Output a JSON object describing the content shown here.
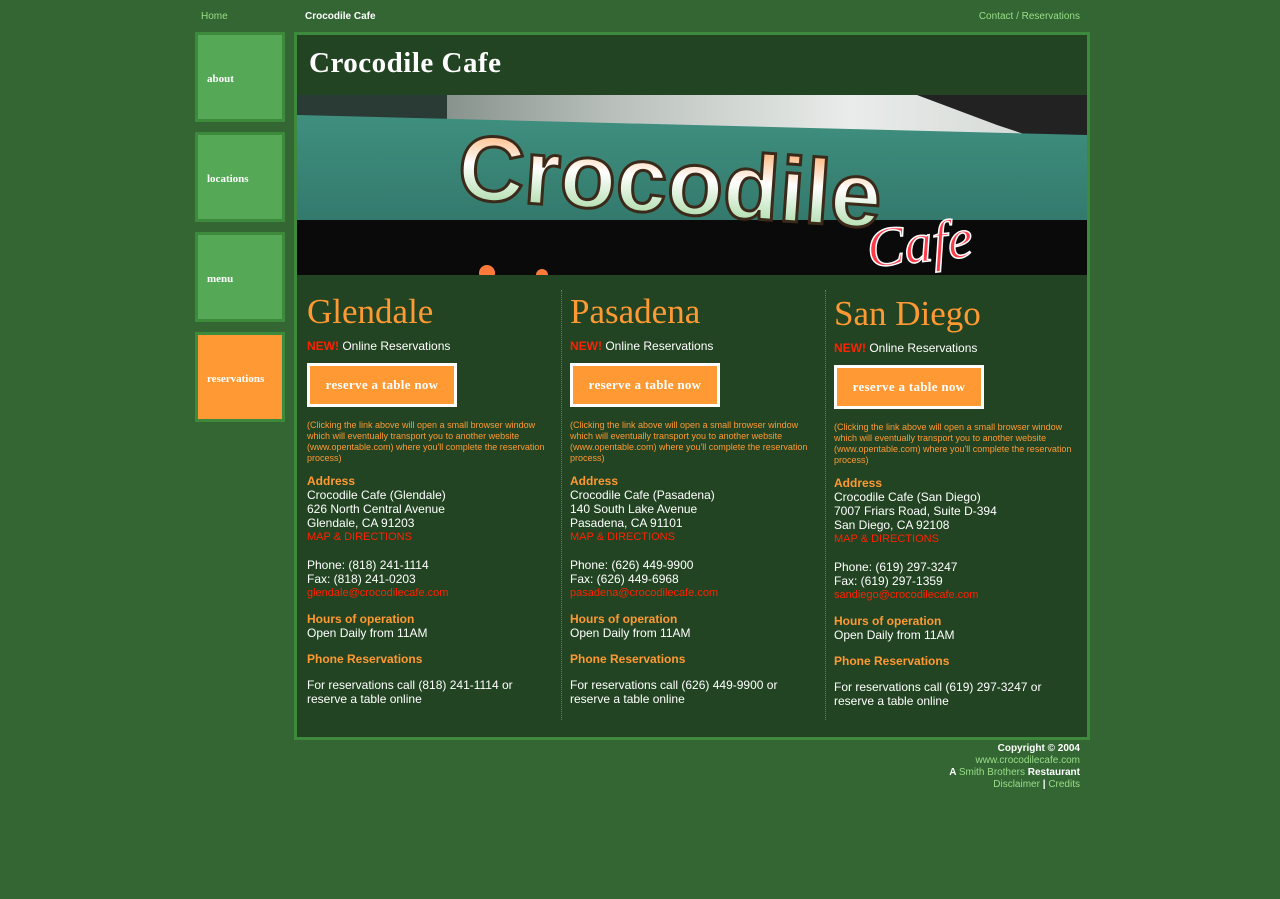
{
  "topbar": {
    "home": "Home",
    "site_title": "Crocodile Cafe",
    "contact": "Contact / Reservations"
  },
  "nav": [
    {
      "label": "about"
    },
    {
      "label": "locations"
    },
    {
      "label": "menu"
    },
    {
      "label": "reservations"
    }
  ],
  "main": {
    "title": "Crocodile Cafe",
    "banner": {
      "sign_word": "Crocodile",
      "sign_cafe": "Cafe"
    }
  },
  "locations": [
    {
      "city": "Glendale",
      "new_label": "NEW!",
      "online_label": "Online Reservations",
      "reserve_button": "reserve a table now",
      "note": "(Clicking the link above will open a small browser window which will eventually transport you to another website (www.opentable.com) where you'll complete the reservation process)",
      "address_heading": "Address",
      "address_lines": [
        "Crocodile Cafe (Glendale)",
        "626 North Central Avenue",
        "Glendale, CA 91203"
      ],
      "map_link": "MAP & DIRECTIONS",
      "phone": "Phone: (818) 241-1114",
      "fax": "Fax: (818) 241-0203",
      "email": "glendale@crocodilecafe.com",
      "hours_heading": "Hours of operation",
      "hours": "Open Daily from 11AM",
      "phone_res_heading": "Phone Reservations",
      "phone_res_text": "For reservations call (818) 241-1114 or reserve a table online"
    },
    {
      "city": "Pasadena",
      "new_label": "NEW!",
      "online_label": "Online Reservations",
      "reserve_button": "reserve a table now",
      "note": "(Clicking the link above will open a small browser window which will eventually transport you to another website (www.opentable.com) where you'll complete the reservation process)",
      "address_heading": "Address",
      "address_lines": [
        "Crocodile Cafe (Pasadena)",
        "140 South Lake Avenue",
        "Pasadena, CA 91101"
      ],
      "map_link": "MAP & DIRECTIONS",
      "phone": "Phone: (626) 449-9900",
      "fax": "Fax: (626) 449-6968",
      "email": "pasadena@crocodilecafe.com",
      "hours_heading": "Hours of operation",
      "hours": "Open Daily from 11AM",
      "phone_res_heading": "Phone Reservations",
      "phone_res_text": "For reservations call (626) 449-9900 or reserve a table online"
    },
    {
      "city": "San Diego",
      "new_label": "NEW!",
      "online_label": "Online Reservations",
      "reserve_button": "reserve a table now",
      "note": "(Clicking the link above will open a small browser window which will eventually transport you to another website (www.opentable.com) where you'll complete the reservation process)",
      "address_heading": "Address",
      "address_lines": [
        "Crocodile Cafe (San Diego)",
        "7007 Friars Road, Suite D-394",
        "San Diego, CA 92108"
      ],
      "map_link": "MAP & DIRECTIONS",
      "phone": "Phone: (619) 297-3247",
      "fax": "Fax: (619) 297-1359",
      "email": "sandiego@crocodilecafe.com",
      "hours_heading": "Hours of operation",
      "hours": "Open Daily from 11AM",
      "phone_res_heading": "Phone Reservations",
      "phone_res_text": "For reservations call (619) 297-3247 or reserve a table online"
    }
  ],
  "footer": {
    "copyright": "Copyright © 2004",
    "site_link": "www.crocodilecafe.com",
    "a_prefix": "A",
    "brothers_link": "Smith Brothers",
    "restaurant": "Restaurant",
    "disclaimer": "Disclaimer",
    "separator": "|",
    "credits": "Credits"
  },
  "colors": {
    "page_bg": "#336633",
    "panel_bg": "#224422",
    "nav_green": "#55a855",
    "accent_orange": "#ff9933",
    "alert_red": "#ff2200",
    "link_green": "#99dd88"
  }
}
